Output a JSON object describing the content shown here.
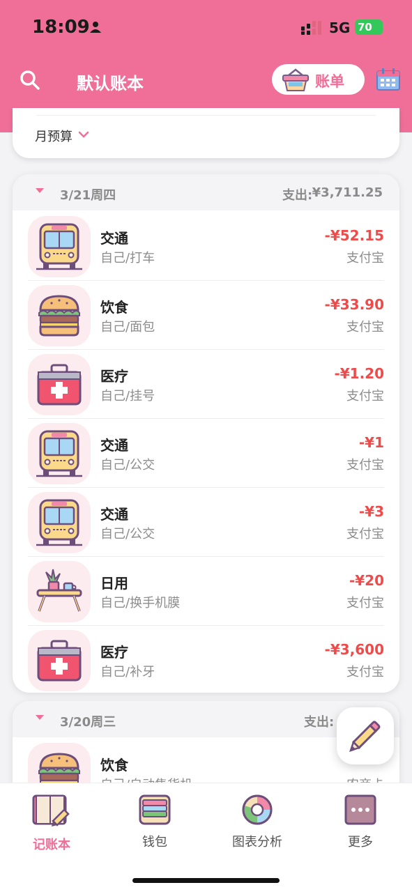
{
  "status": {
    "time": "18:09",
    "network": "5G",
    "battery": "70"
  },
  "header": {
    "title": "默认账本",
    "bill_label": "账单"
  },
  "budget": {
    "label": "月预算"
  },
  "days": [
    {
      "date": "3/21周四",
      "total_label": "支出:",
      "total": "¥3,711.25",
      "items": [
        {
          "icon": "bus-icon",
          "category": "交通",
          "detail": "自己/打车",
          "amount": "-¥52.15",
          "account": "支付宝"
        },
        {
          "icon": "burger-icon",
          "category": "饮食",
          "detail": "自己/面包",
          "amount": "-¥33.90",
          "account": "支付宝"
        },
        {
          "icon": "medical-kit-icon",
          "category": "医疗",
          "detail": "自己/挂号",
          "amount": "-¥1.20",
          "account": "支付宝"
        },
        {
          "icon": "bus-icon",
          "category": "交通",
          "detail": "自己/公交",
          "amount": "-¥1",
          "account": "支付宝"
        },
        {
          "icon": "bus-icon",
          "category": "交通",
          "detail": "自己/公交",
          "amount": "-¥3",
          "account": "支付宝"
        },
        {
          "icon": "table-plant-icon",
          "category": "日用",
          "detail": "自己/换手机膜",
          "amount": "-¥20",
          "account": "支付宝"
        },
        {
          "icon": "medical-kit-icon",
          "category": "医疗",
          "detail": "自己/补牙",
          "amount": "-¥3,600",
          "account": "支付宝"
        }
      ]
    },
    {
      "date": "3/20周三",
      "total_label": "支出:",
      "total": "",
      "items": [
        {
          "icon": "burger-icon",
          "category": "饮食",
          "detail": "自己/自动售货机",
          "amount": "",
          "account": "农商卡"
        }
      ]
    }
  ],
  "tabs": [
    {
      "label": "记账本",
      "icon": "notebook-icon",
      "active": true
    },
    {
      "label": "钱包",
      "icon": "wallet-icon",
      "active": false
    },
    {
      "label": "图表分析",
      "icon": "pie-chart-icon",
      "active": false
    },
    {
      "label": "更多",
      "icon": "more-icon",
      "active": false
    }
  ],
  "colors": {
    "accent": "#ef6f98",
    "expense": "#ee4b4b"
  }
}
